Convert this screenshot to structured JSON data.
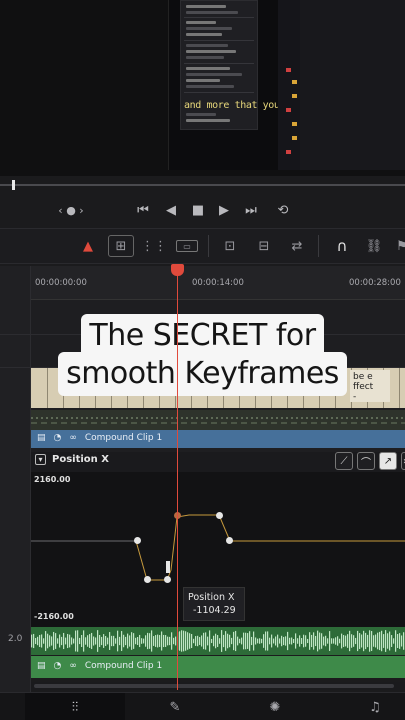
{
  "viewer": {
    "caption": "and more that you want"
  },
  "transport": {
    "jog_label": "‹ ● ›",
    "first": "⏮",
    "prev": "◀",
    "stop": "■",
    "play": "▶",
    "last": "⏭",
    "loop": "⟲"
  },
  "toolbar": {
    "select": "▲",
    "trim": "⊞",
    "dynamic_trim": "⋮⋮",
    "blade": "▭",
    "insert": "⊡",
    "overwrite": "⊟",
    "replace": "⇄",
    "snap": "∩",
    "link": "⛓",
    "flag": "⚑"
  },
  "timeline": {
    "timecodes": [
      "00:00:00:00",
      "00:00:14:00",
      "00:00:28:00"
    ],
    "video_clip_label": "be e\nffect\n-",
    "clip_name_top": "Compound Clip 1",
    "clip_name_bottom": "Compound Clip 1",
    "audio_track_number": "2.0"
  },
  "overlay_caption": {
    "line1": "The SECRET for",
    "line2": "smooth Keyframes"
  },
  "curve_editor": {
    "title": "Position X",
    "y_max": "2160.00",
    "y_min": "-2160.00",
    "tooltip_name": "Position X",
    "tooltip_value": "-1104.29",
    "keyframe_count": 7
  },
  "bottom_nav": [
    "edit-icon",
    "fusion-icon",
    "color-icon",
    "fairlight-icon"
  ],
  "colors": {
    "playhead": "#e04a3c",
    "video_clip_bar": "#46709a",
    "audio_clip": "#3e8a49",
    "curve": "#c79a3d"
  }
}
